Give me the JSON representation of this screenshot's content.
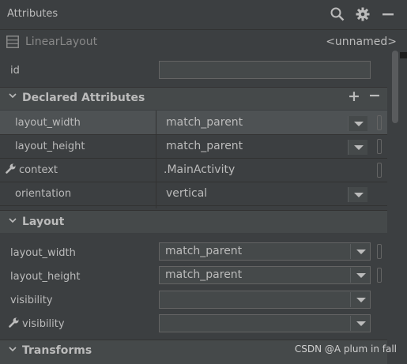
{
  "panel": {
    "title": "Attributes",
    "icons": [
      "search-icon",
      "gear-icon",
      "minimize-icon"
    ]
  },
  "component": {
    "icon": "linear-layout-icon",
    "type": "LinearLayout",
    "id": "<unnamed>"
  },
  "id_field": {
    "label": "id",
    "value": ""
  },
  "declared": {
    "title": "Declared Attributes",
    "add_label": "+",
    "remove_label": "−",
    "rows": [
      {
        "label": "layout_width",
        "value": "match_parent"
      },
      {
        "label": "layout_height",
        "value": "match_parent"
      },
      {
        "label": "context",
        "value": ".MainActivity"
      },
      {
        "label": "orientation",
        "value": "vertical"
      }
    ]
  },
  "layout": {
    "title": "Layout",
    "rows": [
      {
        "label": "layout_width",
        "value": "match_parent"
      },
      {
        "label": "layout_height",
        "value": "match_parent"
      },
      {
        "label": "visibility",
        "value": ""
      },
      {
        "label": "visibility",
        "value": ""
      }
    ]
  },
  "transforms": {
    "title": "Transforms"
  },
  "watermark": "CSDN @A plum in fall"
}
